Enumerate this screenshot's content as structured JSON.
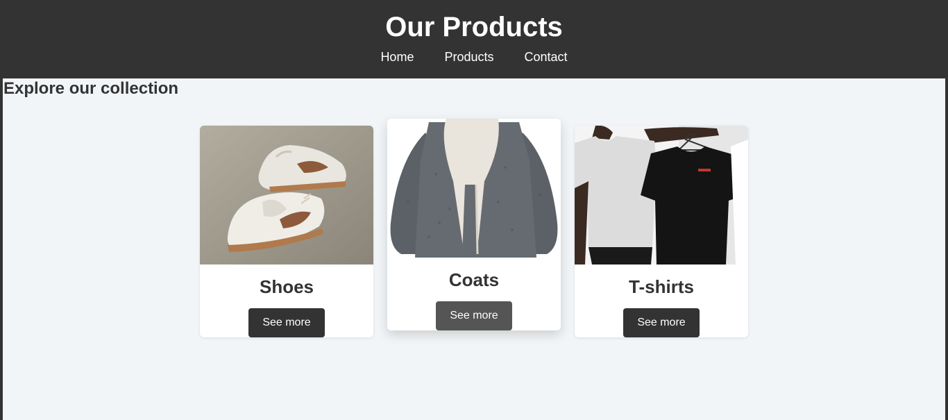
{
  "header": {
    "title": "Our Products",
    "nav": [
      "Home",
      "Products",
      "Contact"
    ]
  },
  "main": {
    "heading": "Explore our collection",
    "products": [
      {
        "name": "Shoes",
        "button": "See more",
        "image": "white-sneakers-photo"
      },
      {
        "name": "Coats",
        "button": "See more",
        "image": "grey-sherpa-coat-photo"
      },
      {
        "name": "T-shirts",
        "button": "See more",
        "image": "tshirts-photo"
      }
    ]
  },
  "colors": {
    "header_bg": "#333333",
    "page_bg": "#f2f5f8",
    "button_bg": "#333333",
    "button_hover_bg": "#555555",
    "text": "#333333"
  }
}
